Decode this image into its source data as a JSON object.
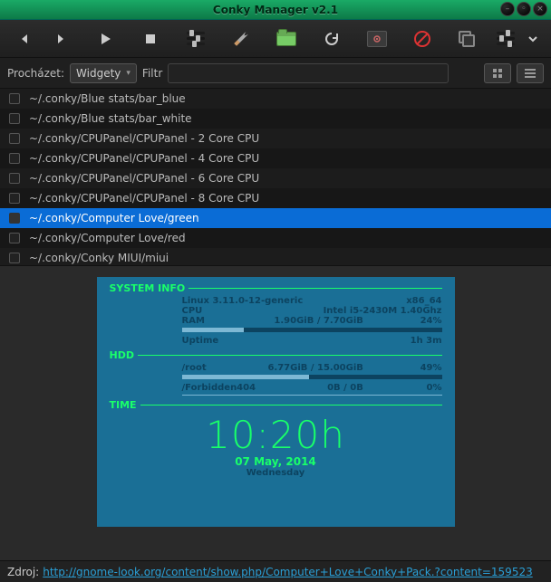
{
  "window": {
    "title": "Conky Manager v2.1"
  },
  "filterbar": {
    "browse_label": "Procházet:",
    "combo_value": "Widgety",
    "filter_label": "Filtr"
  },
  "list": {
    "items": [
      {
        "label": "~/.conky/Blue stats/bar_blue",
        "selected": false
      },
      {
        "label": "~/.conky/Blue stats/bar_white",
        "selected": false
      },
      {
        "label": "~/.conky/CPUPanel/CPUPanel - 2 Core CPU",
        "selected": false
      },
      {
        "label": "~/.conky/CPUPanel/CPUPanel - 4 Core CPU",
        "selected": false
      },
      {
        "label": "~/.conky/CPUPanel/CPUPanel - 6 Core CPU",
        "selected": false
      },
      {
        "label": "~/.conky/CPUPanel/CPUPanel - 8 Core CPU",
        "selected": false
      },
      {
        "label": "~/.conky/Computer Love/green",
        "selected": true
      },
      {
        "label": "~/.conky/Computer Love/red",
        "selected": false
      },
      {
        "label": "~/.conky/Conky MIUI/miui",
        "selected": false
      }
    ]
  },
  "preview": {
    "sections": {
      "system": "SYSTEM INFO",
      "hdd": "HDD",
      "time": "TIME"
    },
    "sys": {
      "kernel": "Linux 3.11.0-12-generic",
      "arch": "x86_64",
      "cpu_label": "CPU",
      "cpu_model": "Intel i5-2430M 1.40Ghz",
      "ram_label": "RAM",
      "ram_used": "1.90GiB / 7.70GiB",
      "ram_pct": "24%",
      "uptime_label": "Uptime",
      "uptime": "1h 3m"
    },
    "hdd": {
      "root_label": "/root",
      "root_used": "6.77GiB / 15.00GiB",
      "root_pct": "49%",
      "f404_label": "/Forbidden404",
      "f404_used": "0B  /  0B",
      "f404_pct": "0%"
    },
    "clock": {
      "time": "10:20h",
      "date": "07 May, 2014",
      "dow": "Wednesday"
    }
  },
  "status": {
    "label": "Zdroj:",
    "link": "http://gnome-look.org/content/show.php/Computer+Love+Conky+Pack.?content=159523"
  }
}
